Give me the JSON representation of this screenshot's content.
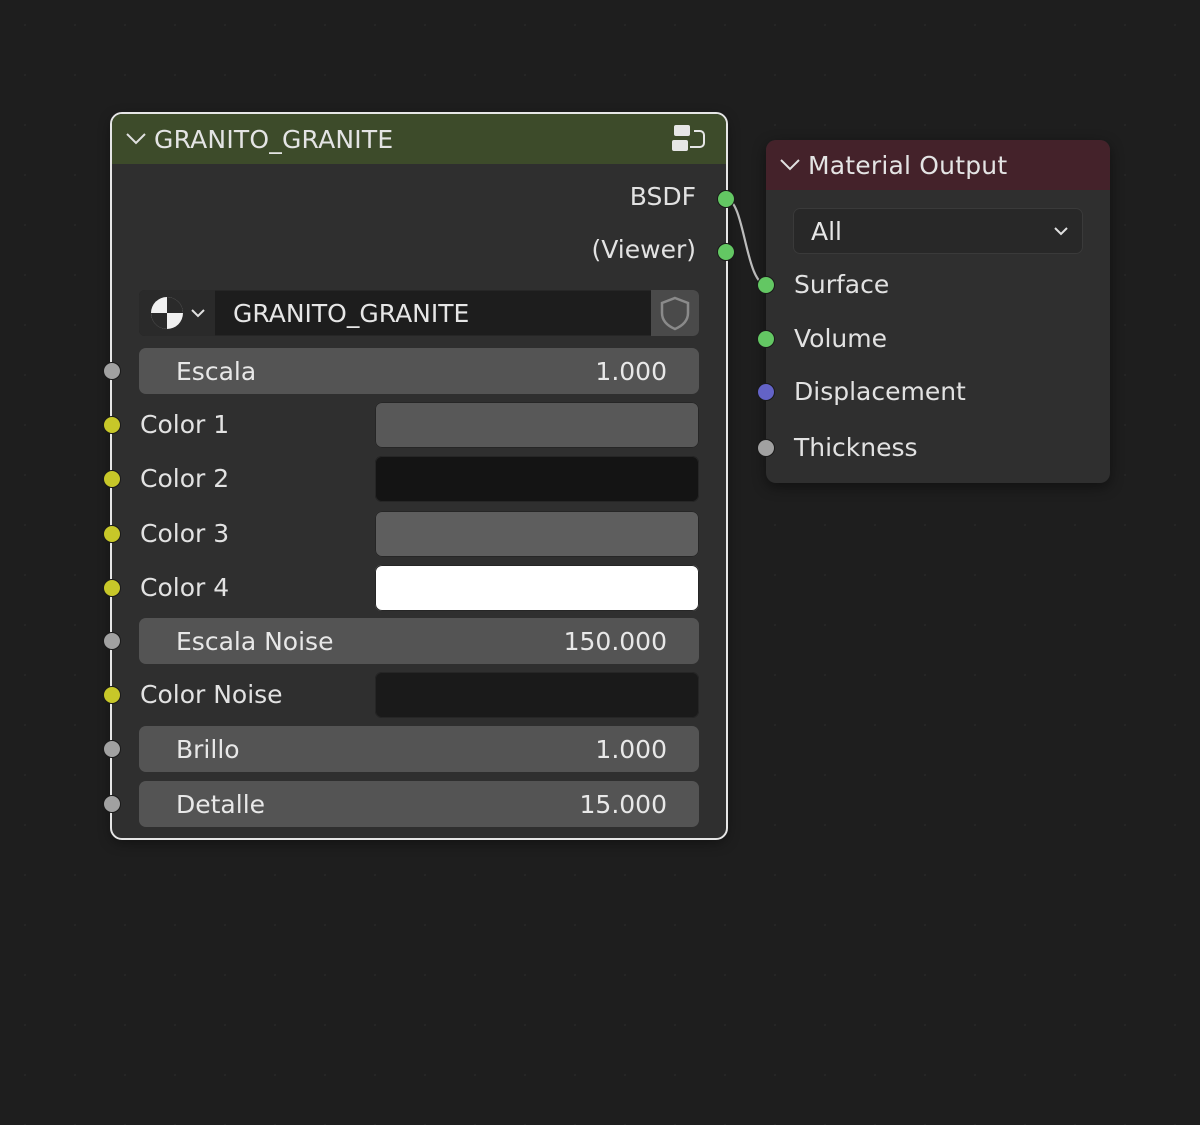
{
  "group_node": {
    "title": "GRANITO_GRANITE",
    "outputs": [
      {
        "label": "BSDF",
        "socket": "shader"
      },
      {
        "label": "(Viewer)",
        "socket": "shader"
      }
    ],
    "datablock": {
      "type_icon": "node-tree-icon",
      "name": "GRANITO_GRANITE",
      "fake_user_icon": "shield-icon"
    },
    "inputs": [
      {
        "kind": "number",
        "label": "Escala",
        "value": "1.000",
        "socket": "float"
      },
      {
        "kind": "color",
        "label": "Color 1",
        "color": "#585858",
        "socket": "color"
      },
      {
        "kind": "color",
        "label": "Color 2",
        "color": "#141414",
        "socket": "color"
      },
      {
        "kind": "color",
        "label": "Color 3",
        "color": "#5e5e5e",
        "socket": "color"
      },
      {
        "kind": "color",
        "label": "Color 4",
        "color": "#ffffff",
        "socket": "color"
      },
      {
        "kind": "number",
        "label": "Escala Noise",
        "value": "150.000",
        "socket": "float"
      },
      {
        "kind": "color",
        "label": "Color Noise",
        "color": "#1a1a1a",
        "socket": "color"
      },
      {
        "kind": "number",
        "label": "Brillo",
        "value": "1.000",
        "socket": "float"
      },
      {
        "kind": "number",
        "label": "Detalle",
        "value": "15.000",
        "socket": "float"
      }
    ]
  },
  "output_node": {
    "title": "Material Output",
    "target": "All",
    "inputs": [
      {
        "label": "Surface",
        "socket": "shader"
      },
      {
        "label": "Volume",
        "socket": "shader"
      },
      {
        "label": "Displacement",
        "socket": "vector"
      },
      {
        "label": "Thickness",
        "socket": "float"
      }
    ]
  },
  "colors": {
    "group_header": "#3d4b2a",
    "output_header": "#44222a",
    "socket_shader": "#63c763",
    "socket_color": "#c7c729",
    "socket_float": "#a1a1a1",
    "socket_vector": "#6363c7"
  }
}
